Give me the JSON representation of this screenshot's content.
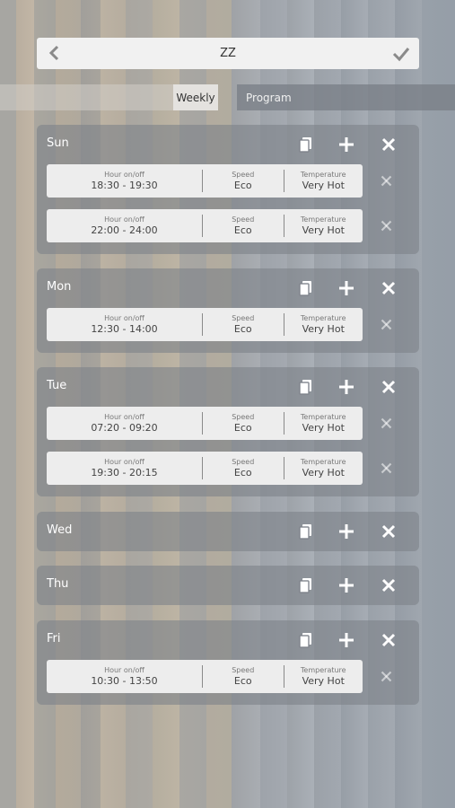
{
  "header": {
    "title": "ZZ"
  },
  "tabs": {
    "weekly": "Weekly",
    "program": "Program"
  },
  "labels": {
    "hour": "Hour on/off",
    "speed": "Speed",
    "temperature": "Temperature"
  },
  "days": [
    {
      "name": "Sun",
      "entries": [
        {
          "hours": "18:30 - 19:30",
          "speed": "Eco",
          "temperature": "Very Hot"
        },
        {
          "hours": "22:00 - 24:00",
          "speed": "Eco",
          "temperature": "Very Hot"
        }
      ]
    },
    {
      "name": "Mon",
      "entries": [
        {
          "hours": "12:30 - 14:00",
          "speed": "Eco",
          "temperature": "Very Hot"
        }
      ]
    },
    {
      "name": "Tue",
      "entries": [
        {
          "hours": "07:20 - 09:20",
          "speed": "Eco",
          "temperature": "Very Hot"
        },
        {
          "hours": "19:30 - 20:15",
          "speed": "Eco",
          "temperature": "Very Hot"
        }
      ]
    },
    {
      "name": "Wed",
      "entries": []
    },
    {
      "name": "Thu",
      "entries": []
    },
    {
      "name": "Fri",
      "entries": [
        {
          "hours": "10:30 - 13:50",
          "speed": "Eco",
          "temperature": "Very Hot"
        }
      ]
    }
  ],
  "icons": {
    "back": "chevron-left-icon",
    "confirm": "checkmark-icon",
    "copy": "copy-icon",
    "add": "plus-icon",
    "delete": "close-icon"
  }
}
